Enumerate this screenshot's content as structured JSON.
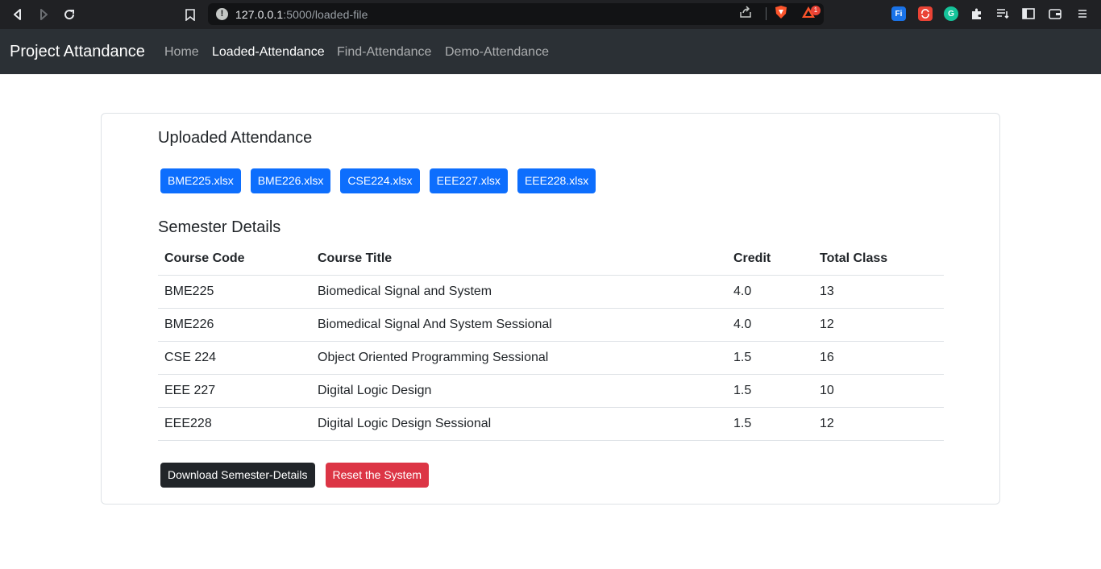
{
  "browser": {
    "url_host": "127.0.0.1",
    "url_path": ":5000/loaded-file",
    "notification_count": "1",
    "ext_fi_label": "Fi",
    "ext_g_label": "G"
  },
  "navbar": {
    "brand": "Project Attandance",
    "links": [
      {
        "label": "Home"
      },
      {
        "label": "Loaded-Attendance"
      },
      {
        "label": "Find-Attendance"
      },
      {
        "label": "Demo-Attendance"
      }
    ]
  },
  "uploaded": {
    "title": "Uploaded Attendance",
    "files": [
      "BME225.xlsx",
      "BME226.xlsx",
      "CSE224.xlsx",
      "EEE227.xlsx",
      "EEE228.xlsx"
    ]
  },
  "semester": {
    "title": "Semester Details",
    "headers": [
      "Course Code",
      "Course Title",
      "Credit",
      "Total Class"
    ],
    "rows": [
      [
        "BME225",
        "Biomedical Signal and System",
        "4.0",
        "13"
      ],
      [
        "BME226",
        "Biomedical Signal And System Sessional",
        "4.0",
        "12"
      ],
      [
        "CSE 224",
        "Object Oriented Programming Sessional",
        "1.5",
        "16"
      ],
      [
        "EEE 227",
        "Digital Logic Design",
        "1.5",
        "10"
      ],
      [
        "EEE228",
        "Digital Logic Design Sessional",
        "1.5",
        "12"
      ]
    ]
  },
  "actions": {
    "download_label": "Download Semester-Details",
    "reset_label": "Reset the System"
  },
  "colors": {
    "primary": "#0d6efd",
    "danger": "#dc3545",
    "dark": "#212529",
    "navbar": "#2b3035"
  }
}
